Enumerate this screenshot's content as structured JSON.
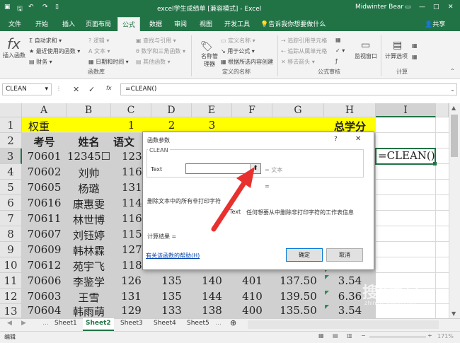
{
  "titlebar": {
    "title": "excel学生成绩单 [兼容模式] - Excel",
    "user": "Midwinter Bear",
    "bg_color": "#217346"
  },
  "tabs": [
    "文件",
    "开始",
    "插入",
    "页面布局",
    "公式",
    "数据",
    "审阅",
    "视图",
    "开发工具",
    "帮助"
  ],
  "tell_me": "告诉我你想要做什么",
  "share": "共享",
  "ribbon": {
    "insert_function": "插入函数",
    "autosum": "自动求和",
    "recent": "最近使用的函数",
    "financial": "财务",
    "logical": "逻辑",
    "text": "文本",
    "datetime": "日期和时间",
    "lookup": "查找与引用",
    "math": "数学和三角函数",
    "more": "其他函数",
    "group_library": "函数库",
    "name_manager": "名称管理器",
    "define_name": "定义名称",
    "use_in_formula": "用于公式",
    "create_from_sel": "根据所选内容创建",
    "group_names": "定义的名称",
    "trace_precedents": "追踪引用单元格",
    "trace_dependents": "追踪从属单元格",
    "remove_arrows": "移去箭头",
    "group_audit": "公式审核",
    "watch_window": "监视窗口",
    "calc_options": "计算选项",
    "group_calc": "计算"
  },
  "namebox": "CLEAN",
  "formula": "=CLEAN()",
  "columns": [
    "A",
    "B",
    "C",
    "D",
    "E",
    "F",
    "G",
    "H",
    "I"
  ],
  "row1": {
    "a": "权重",
    "c": "1",
    "d": "2",
    "e": "3",
    "h": "总学分"
  },
  "row2": {
    "a": "考号",
    "b": "姓名",
    "c": "语文"
  },
  "i3": "=CLEAN()",
  "rows": [
    {
      "n": "3",
      "a": "70601",
      "b": "12345☐",
      "c": "123"
    },
    {
      "n": "4",
      "a": "70602",
      "b": "刘帅",
      "c": "116"
    },
    {
      "n": "5",
      "a": "70605",
      "b": "杨璐",
      "c": "131"
    },
    {
      "n": "6",
      "a": "70616",
      "b": "康惠雯",
      "c": "114"
    },
    {
      "n": "7",
      "a": "70611",
      "b": "林世博",
      "c": "116"
    },
    {
      "n": "8",
      "a": "70607",
      "b": "刘钰婷",
      "c": "115"
    },
    {
      "n": "9",
      "a": "70609",
      "b": "韩林霖",
      "c": "127"
    },
    {
      "n": "10",
      "a": "70612",
      "b": "苑宇飞",
      "c": "118"
    },
    {
      "n": "11",
      "a": "70606",
      "b": "李鉴学",
      "c": "126",
      "d": "135",
      "e": "140",
      "f": "401",
      "g": "137.50",
      "h": "3.54"
    },
    {
      "n": "12",
      "a": "70603",
      "b": "王雪",
      "c": "131",
      "d": "135",
      "e": "144",
      "f": "410",
      "g": "139.50",
      "h": "6.36"
    },
    {
      "n": "13",
      "a": "70604",
      "b": "韩雨萌",
      "c": "129",
      "d": "133",
      "e": "138",
      "f": "400",
      "g": "135.50",
      "h": "3.54"
    }
  ],
  "sheets": [
    "Sheet1",
    "Sheet2",
    "Sheet3",
    "Sheet4",
    "Sheet5"
  ],
  "status": "编辑",
  "zoom": "171%",
  "dialog": {
    "title": "函数参数",
    "help_q": "?",
    "fn_name": "CLEAN",
    "arg_label": "Text",
    "arg_hint": "= 文本",
    "result_eq": "=",
    "description": "删除文本中的所有非打印字符",
    "arg_desc_label": "Text",
    "arg_desc": "任何想要从中删除非打印字符的工作表信息",
    "calc_result": "计算结果 =",
    "help_link": "有关该函数的帮助(H)",
    "ok": "确定",
    "cancel": "取消"
  },
  "watermark": "搜狗指南",
  "watermark_url": "zhinan.sogou.com"
}
